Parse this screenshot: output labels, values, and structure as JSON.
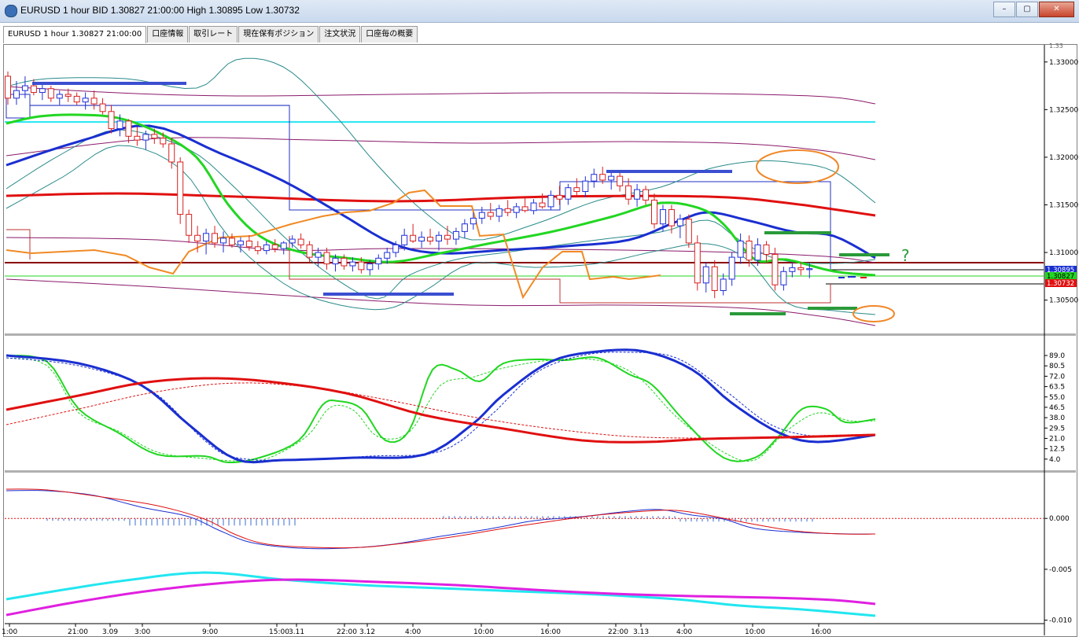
{
  "window": {
    "title": "EURUSD 1 hour BID 1.30827 21:00:00 High 1.30895 Low 1.30732",
    "buttons": [
      "–",
      "▢",
      "✕"
    ]
  },
  "tabs": [
    {
      "label": "EURUSD 1 hour 1.30827 21:00:00",
      "active": true
    },
    {
      "label": "口座情報",
      "active": false
    },
    {
      "label": "取引レート",
      "active": false
    },
    {
      "label": "現在保有ポジション",
      "active": false
    },
    {
      "label": "注文状況",
      "active": false
    },
    {
      "label": "口座毎の概要",
      "active": false
    }
  ],
  "colors": {
    "bull_candle": "#1f2fd8",
    "bear_candle": "#d81f1f",
    "orange_line": "#f08a24",
    "green_line": "#22d622",
    "blue_ma": "#1a2fd0",
    "red_ma": "#e01010",
    "cyan_line": "#22e6f0",
    "purple_band": "#8a1a6a",
    "teal_band": "#2a8a8a",
    "magenta_line": "#e020e0",
    "annotation_blue": "#3a4fd0",
    "annotation_green": "#2a9a3a",
    "annotation_orange": "#f0882a"
  },
  "annotation_text": "?",
  "chart_data": [
    {
      "type": "line",
      "name": "price",
      "candles": [
        {
          "o": 1.3285,
          "h": 1.329,
          "l": 1.3255,
          "c": 1.3262
        },
        {
          "o": 1.3262,
          "h": 1.328,
          "l": 1.3255,
          "c": 1.327
        },
        {
          "o": 1.327,
          "h": 1.3285,
          "l": 1.3262,
          "c": 1.3275
        },
        {
          "o": 1.3275,
          "h": 1.3282,
          "l": 1.3265,
          "c": 1.3268
        },
        {
          "o": 1.3268,
          "h": 1.3278,
          "l": 1.326,
          "c": 1.3272
        },
        {
          "o": 1.3272,
          "h": 1.3275,
          "l": 1.3258,
          "c": 1.3262
        },
        {
          "o": 1.3262,
          "h": 1.327,
          "l": 1.3255,
          "c": 1.3266
        },
        {
          "o": 1.3266,
          "h": 1.3272,
          "l": 1.3258,
          "c": 1.3264
        },
        {
          "o": 1.3264,
          "h": 1.3268,
          "l": 1.3255,
          "c": 1.3258
        },
        {
          "o": 1.3258,
          "h": 1.3268,
          "l": 1.325,
          "c": 1.3262
        },
        {
          "o": 1.3262,
          "h": 1.327,
          "l": 1.325,
          "c": 1.3256
        },
        {
          "o": 1.3256,
          "h": 1.3262,
          "l": 1.3245,
          "c": 1.3248
        },
        {
          "o": 1.3248,
          "h": 1.3255,
          "l": 1.3225,
          "c": 1.323
        },
        {
          "o": 1.323,
          "h": 1.3245,
          "l": 1.3222,
          "c": 1.3238
        },
        {
          "o": 1.3238,
          "h": 1.324,
          "l": 1.3215,
          "c": 1.3222
        },
        {
          "o": 1.3222,
          "h": 1.3232,
          "l": 1.3212,
          "c": 1.3218
        },
        {
          "o": 1.3218,
          "h": 1.3228,
          "l": 1.3208,
          "c": 1.3224
        },
        {
          "o": 1.3224,
          "h": 1.323,
          "l": 1.3214,
          "c": 1.322
        },
        {
          "o": 1.322,
          "h": 1.3226,
          "l": 1.321,
          "c": 1.3214
        },
        {
          "o": 1.3214,
          "h": 1.322,
          "l": 1.3188,
          "c": 1.3195
        },
        {
          "o": 1.3195,
          "h": 1.32,
          "l": 1.313,
          "c": 1.314
        },
        {
          "o": 1.314,
          "h": 1.3145,
          "l": 1.311,
          "c": 1.3118
        },
        {
          "o": 1.3118,
          "h": 1.3128,
          "l": 1.31,
          "c": 1.3112
        },
        {
          "o": 1.3112,
          "h": 1.3125,
          "l": 1.3098,
          "c": 1.312
        },
        {
          "o": 1.312,
          "h": 1.3128,
          "l": 1.3105,
          "c": 1.311
        },
        {
          "o": 1.311,
          "h": 1.3122,
          "l": 1.31,
          "c": 1.3115
        },
        {
          "o": 1.3115,
          "h": 1.312,
          "l": 1.3105,
          "c": 1.3108
        },
        {
          "o": 1.3108,
          "h": 1.3116,
          "l": 1.31,
          "c": 1.3112
        },
        {
          "o": 1.3112,
          "h": 1.3118,
          "l": 1.3102,
          "c": 1.3106
        },
        {
          "o": 1.3106,
          "h": 1.3112,
          "l": 1.3098,
          "c": 1.3102
        },
        {
          "o": 1.3102,
          "h": 1.3112,
          "l": 1.3098,
          "c": 1.3108
        },
        {
          "o": 1.3108,
          "h": 1.3114,
          "l": 1.31,
          "c": 1.3104
        },
        {
          "o": 1.3104,
          "h": 1.3112,
          "l": 1.3098,
          "c": 1.311
        },
        {
          "o": 1.311,
          "h": 1.3118,
          "l": 1.3105,
          "c": 1.3114
        },
        {
          "o": 1.3114,
          "h": 1.312,
          "l": 1.3104,
          "c": 1.3108
        },
        {
          "o": 1.3108,
          "h": 1.3112,
          "l": 1.309,
          "c": 1.3095
        },
        {
          "o": 1.3095,
          "h": 1.3105,
          "l": 1.3085,
          "c": 1.31
        },
        {
          "o": 1.31,
          "h": 1.3105,
          "l": 1.3082,
          "c": 1.3088
        },
        {
          "o": 1.3088,
          "h": 1.3098,
          "l": 1.308,
          "c": 1.3094
        },
        {
          "o": 1.3094,
          "h": 1.3098,
          "l": 1.3082,
          "c": 1.3086
        },
        {
          "o": 1.3086,
          "h": 1.3095,
          "l": 1.308,
          "c": 1.309
        },
        {
          "o": 1.309,
          "h": 1.3095,
          "l": 1.3078,
          "c": 1.3082
        },
        {
          "o": 1.3082,
          "h": 1.3092,
          "l": 1.3076,
          "c": 1.3088
        },
        {
          "o": 1.3088,
          "h": 1.3098,
          "l": 1.3082,
          "c": 1.3094
        },
        {
          "o": 1.3094,
          "h": 1.3105,
          "l": 1.3088,
          "c": 1.31
        },
        {
          "o": 1.31,
          "h": 1.3112,
          "l": 1.3095,
          "c": 1.3108
        },
        {
          "o": 1.3108,
          "h": 1.3125,
          "l": 1.3102,
          "c": 1.3118
        },
        {
          "o": 1.3118,
          "h": 1.313,
          "l": 1.311,
          "c": 1.3112
        },
        {
          "o": 1.3112,
          "h": 1.3122,
          "l": 1.3105,
          "c": 1.3116
        },
        {
          "o": 1.3116,
          "h": 1.3125,
          "l": 1.3108,
          "c": 1.3112
        },
        {
          "o": 1.3112,
          "h": 1.3122,
          "l": 1.3102,
          "c": 1.3118
        },
        {
          "o": 1.3118,
          "h": 1.3128,
          "l": 1.3108,
          "c": 1.3114
        },
        {
          "o": 1.3114,
          "h": 1.3126,
          "l": 1.3108,
          "c": 1.3122
        },
        {
          "o": 1.3122,
          "h": 1.3135,
          "l": 1.3115,
          "c": 1.313
        },
        {
          "o": 1.313,
          "h": 1.3142,
          "l": 1.3124,
          "c": 1.3136
        },
        {
          "o": 1.3136,
          "h": 1.3148,
          "l": 1.313,
          "c": 1.3142
        },
        {
          "o": 1.3142,
          "h": 1.3152,
          "l": 1.3134,
          "c": 1.3138
        },
        {
          "o": 1.3138,
          "h": 1.315,
          "l": 1.3132,
          "c": 1.3146
        },
        {
          "o": 1.3146,
          "h": 1.3155,
          "l": 1.3138,
          "c": 1.3142
        },
        {
          "o": 1.3142,
          "h": 1.3152,
          "l": 1.3136,
          "c": 1.3148
        },
        {
          "o": 1.3148,
          "h": 1.3158,
          "l": 1.3142,
          "c": 1.3144
        },
        {
          "o": 1.3144,
          "h": 1.3156,
          "l": 1.314,
          "c": 1.3152
        },
        {
          "o": 1.3152,
          "h": 1.3162,
          "l": 1.3146,
          "c": 1.3148
        },
        {
          "o": 1.3148,
          "h": 1.3165,
          "l": 1.3145,
          "c": 1.316
        },
        {
          "o": 1.316,
          "h": 1.317,
          "l": 1.315,
          "c": 1.3156
        },
        {
          "o": 1.3156,
          "h": 1.3172,
          "l": 1.315,
          "c": 1.3168
        },
        {
          "o": 1.3168,
          "h": 1.3178,
          "l": 1.316,
          "c": 1.3164
        },
        {
          "o": 1.3164,
          "h": 1.318,
          "l": 1.3158,
          "c": 1.3175
        },
        {
          "o": 1.3175,
          "h": 1.3188,
          "l": 1.3168,
          "c": 1.3182
        },
        {
          "o": 1.3182,
          "h": 1.319,
          "l": 1.3172,
          "c": 1.3176
        },
        {
          "o": 1.3176,
          "h": 1.3186,
          "l": 1.3166,
          "c": 1.318
        },
        {
          "o": 1.318,
          "h": 1.3184,
          "l": 1.3164,
          "c": 1.317
        },
        {
          "o": 1.317,
          "h": 1.3178,
          "l": 1.315,
          "c": 1.3156
        },
        {
          "o": 1.3156,
          "h": 1.3172,
          "l": 1.3148,
          "c": 1.3166
        },
        {
          "o": 1.3166,
          "h": 1.317,
          "l": 1.315,
          "c": 1.3155
        },
        {
          "o": 1.3155,
          "h": 1.3162,
          "l": 1.3125,
          "c": 1.313
        },
        {
          "o": 1.313,
          "h": 1.315,
          "l": 1.3122,
          "c": 1.3145
        },
        {
          "o": 1.3145,
          "h": 1.315,
          "l": 1.312,
          "c": 1.3128
        },
        {
          "o": 1.3128,
          "h": 1.314,
          "l": 1.3115,
          "c": 1.3135
        },
        {
          "o": 1.3135,
          "h": 1.314,
          "l": 1.3105,
          "c": 1.311
        },
        {
          "o": 1.311,
          "h": 1.3118,
          "l": 1.306,
          "c": 1.3068
        },
        {
          "o": 1.3068,
          "h": 1.309,
          "l": 1.3058,
          "c": 1.3085
        },
        {
          "o": 1.3085,
          "h": 1.3092,
          "l": 1.3052,
          "c": 1.306
        },
        {
          "o": 1.306,
          "h": 1.3078,
          "l": 1.3055,
          "c": 1.3072
        },
        {
          "o": 1.3072,
          "h": 1.31,
          "l": 1.3065,
          "c": 1.3095
        },
        {
          "o": 1.3095,
          "h": 1.312,
          "l": 1.3088,
          "c": 1.3112
        },
        {
          "o": 1.3112,
          "h": 1.3118,
          "l": 1.3085,
          "c": 1.3092
        },
        {
          "o": 1.3092,
          "h": 1.3115,
          "l": 1.3086,
          "c": 1.3108
        },
        {
          "o": 1.3108,
          "h": 1.3112,
          "l": 1.309,
          "c": 1.3098
        },
        {
          "o": 1.3098,
          "h": 1.3105,
          "l": 1.306,
          "c": 1.3066
        },
        {
          "o": 1.3066,
          "h": 1.3085,
          "l": 1.306,
          "c": 1.308
        },
        {
          "o": 1.308,
          "h": 1.309,
          "l": 1.3074,
          "c": 1.3084
        },
        {
          "o": 1.3084,
          "h": 1.309,
          "l": 1.3076,
          "c": 1.3082
        },
        {
          "o": 1.3082,
          "h": 1.3089,
          "l": 1.3073,
          "c": 1.3083
        }
      ],
      "price_axis": {
        "range": [
          1.3015,
          1.3318
        ],
        "ticks": [
          "1.33000",
          "1.32500",
          "1.32000",
          "1.31500",
          "1.31000",
          "1.30500"
        ],
        "tick_values": [
          1.33,
          1.325,
          1.32,
          1.315,
          1.31,
          1.305
        ]
      },
      "price_labels": [
        {
          "text": "1.30895",
          "value": 1.30895,
          "bg": "#1a2fd0",
          "fg": "#ffffff"
        },
        {
          "text": "1.30827",
          "value": 1.30827,
          "bg": "#22d622",
          "fg": "#000000"
        },
        {
          "text": "1.30732",
          "value": 1.30732,
          "bg": "#e01010",
          "fg": "#ffffff"
        }
      ],
      "time_labels": [
        "1:00",
        "21:00",
        "3.09",
        "3:00",
        "9:00",
        "15:00",
        "3.11",
        "22:00",
        "3.12",
        "4:00",
        "10:00",
        "16:00",
        "22:00",
        "3.13",
        "4:00",
        "10:00",
        "16:00"
      ]
    },
    {
      "type": "line",
      "name": "stochastic",
      "axis": {
        "range": [
          0,
          100
        ],
        "ticks": [
          "89.0",
          "80.5",
          "72.0",
          "63.5",
          "55.0",
          "46.5",
          "38.0",
          "29.5",
          "21.0",
          "12.5",
          "4.0"
        ],
        "tick_values": [
          89.0,
          80.5,
          72.0,
          63.5,
          55.0,
          46.5,
          38.0,
          29.5,
          21.0,
          12.5,
          4.0
        ]
      }
    },
    {
      "type": "line",
      "name": "oscillator",
      "axis": {
        "range": [
          -0.0115,
          0.0045
        ],
        "ticks": [
          "0.000",
          "-0.005",
          "-0.010"
        ],
        "tick_values": [
          0.0,
          -0.005,
          -0.01
        ]
      }
    }
  ]
}
